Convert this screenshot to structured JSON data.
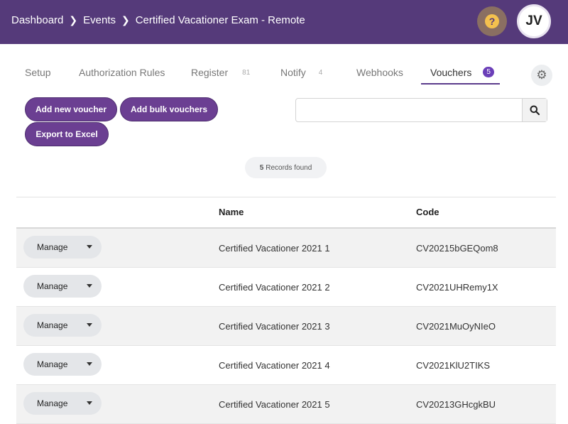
{
  "breadcrumb": [
    "Dashboard",
    "Events",
    "Certified Vacationer Exam - Remote"
  ],
  "header": {
    "help_icon": "question-icon",
    "avatar_initials": "JV"
  },
  "tabs": [
    {
      "label": "Setup"
    },
    {
      "label": "Authorization Rules"
    },
    {
      "label": "Register",
      "count": "81"
    },
    {
      "label": "Notify",
      "count": "4"
    },
    {
      "label": "Webhooks"
    },
    {
      "label": "Vouchers",
      "badge": "5",
      "active": true
    }
  ],
  "actions": {
    "add_new": "Add new voucher",
    "add_bulk": "Add bulk vouchers",
    "export": "Export to Excel"
  },
  "search": {
    "placeholder": "",
    "value": ""
  },
  "records": {
    "count": "5",
    "label": "Records found"
  },
  "table": {
    "columns": [
      "Name",
      "Code"
    ],
    "manage_label": "Manage",
    "rows": [
      {
        "name": "Certified Vacationer 2021 1",
        "code": "CV20215bGEQom8"
      },
      {
        "name": "Certified Vacationer 2021 2",
        "code": "CV2021UHRemy1X"
      },
      {
        "name": "Certified Vacationer 2021 3",
        "code": "CV2021MuOyNIeO"
      },
      {
        "name": "Certified Vacationer 2021 4",
        "code": "CV2021KlU2TIKS"
      },
      {
        "name": "Certified Vacationer 2021 5",
        "code": "CV20213GHcgkBU"
      }
    ]
  },
  "colors": {
    "header": "#553a7a",
    "button": "#6b3f92",
    "tab_active": "#5b3b8c"
  }
}
